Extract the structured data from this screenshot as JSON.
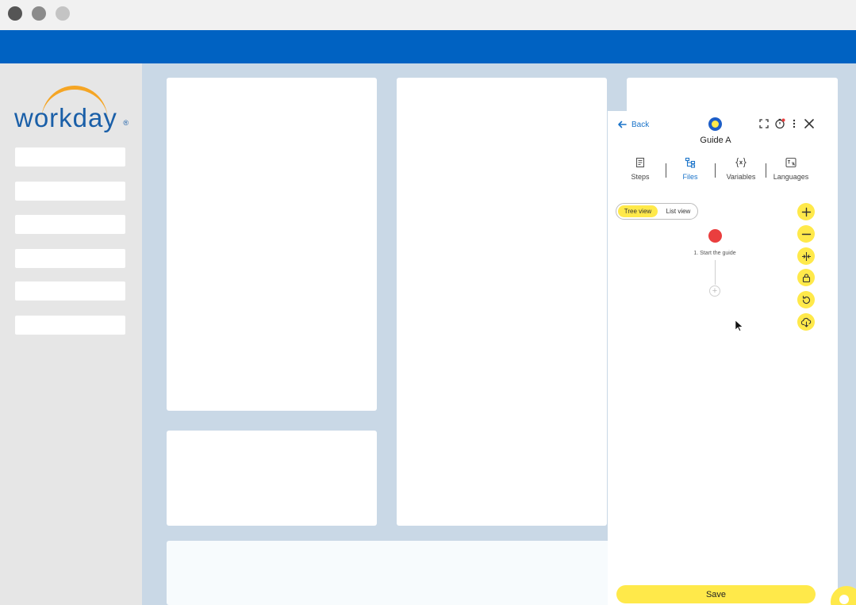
{
  "brand": {
    "name": "workday",
    "registered": "®",
    "primary": "#0062c2",
    "accent": "#f5a524",
    "highlight": "#ffe94a"
  },
  "window": {
    "controls": [
      "close",
      "minimize",
      "maximize"
    ]
  },
  "sidebar": {
    "items": [
      "",
      "",
      "",
      "",
      "",
      ""
    ]
  },
  "panel": {
    "back_label": "Back",
    "title": "Guide A",
    "header_icons": [
      "expand-icon",
      "timer-icon",
      "more-icon",
      "close-icon"
    ],
    "tabs": [
      {
        "label": "Steps",
        "icon": "steps-icon",
        "active": false
      },
      {
        "label": "Files",
        "icon": "tree-icon",
        "active": true
      },
      {
        "label": "Variables",
        "icon": "variable-icon",
        "active": false
      },
      {
        "label": "Languages",
        "icon": "language-icon",
        "active": false
      }
    ],
    "view_toggle": {
      "tree_view": "Tree view",
      "list_view": "List view",
      "selected": "Tree view"
    },
    "tree": {
      "start_node_label": "1. Start the guide",
      "add_symbol": "+"
    },
    "tools": [
      "zoom-in-icon",
      "zoom-out-icon",
      "fit-icon",
      "lock-icon",
      "reset-icon",
      "download-icon"
    ],
    "save_label": "Save"
  }
}
